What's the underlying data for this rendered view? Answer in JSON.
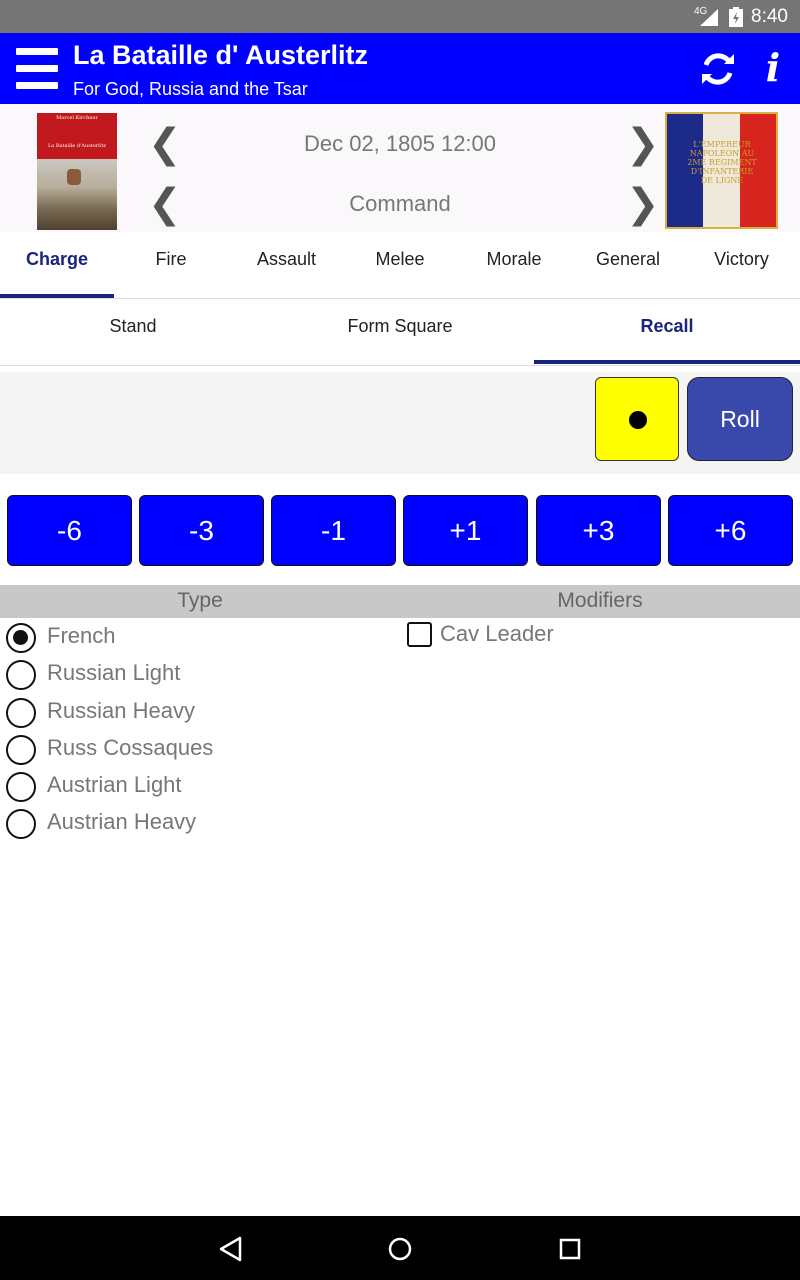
{
  "status_bar": {
    "network": "4G",
    "time": "8:40"
  },
  "app_bar": {
    "title": "La Bataille d' Austerlitz",
    "subtitle": "For God, Russia and the Tsar",
    "menu_icon": "hamburger-menu-icon",
    "sync_icon": "sync-icon",
    "info_icon": "info-icon",
    "info_glyph": "i"
  },
  "header": {
    "date_time": "Dec 02, 1805 12:00",
    "phase": "Command",
    "prev_glyph": "❮",
    "next_glyph": "❯",
    "flag_text": "L'EMPEREUR NAPOLEON AU 2ME REGIMENT D'INFANTERIE DE LIGNE",
    "box_art_caption_top": "Marcel Kirchner",
    "box_art_caption_bottom": "La Bataille d'Austerlitz"
  },
  "tabs": [
    "Charge",
    "Fire",
    "Assault",
    "Melee",
    "Morale",
    "General",
    "Victory"
  ],
  "active_tab": "Charge",
  "subtabs": [
    "Stand",
    "Form Square",
    "Recall"
  ],
  "active_subtab": "Recall",
  "dice": {
    "pips": 1,
    "roll_label": "Roll",
    "color": "#ffff00"
  },
  "modifier_buttons": [
    "-6",
    "-3",
    "-1",
    "+1",
    "+3",
    "+6"
  ],
  "sections": {
    "type_header": "Type",
    "modifiers_header": "Modifiers"
  },
  "types": [
    {
      "label": "French",
      "checked": true
    },
    {
      "label": "Russian Light",
      "checked": false
    },
    {
      "label": "Russian Heavy",
      "checked": false
    },
    {
      "label": "Russ Cossaques",
      "checked": false
    },
    {
      "label": "Austrian Light",
      "checked": false
    },
    {
      "label": "Austrian Heavy",
      "checked": false
    }
  ],
  "modifiers": [
    {
      "label": "Cav Leader",
      "checked": false
    }
  ],
  "colors": {
    "app_bar": "#0000ff",
    "button": "#0000ff",
    "roll_button": "#3949ab",
    "tab_active": "#1a237e"
  }
}
